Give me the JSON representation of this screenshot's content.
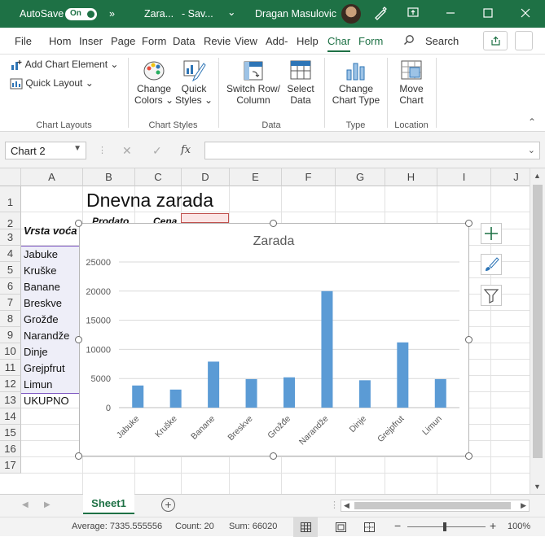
{
  "titlebar": {
    "autosave_label": "AutoSave",
    "autosave_state": "On",
    "more": "»",
    "doc_title": "Zara...",
    "save_state": "- Sav...",
    "dropdown": "⌄",
    "user_name": "Dragan Masulovic"
  },
  "menu": {
    "file": "File",
    "home": "Hom",
    "insert": "Inser",
    "page": "Page",
    "formulas": "Form",
    "data": "Data",
    "review": "Revie",
    "view": "View",
    "addins": "Add-",
    "help": "Help",
    "chart_design": "Char",
    "format": "Form",
    "search": "Search"
  },
  "ribbon": {
    "add_chart_element": "Add Chart Element",
    "quick_layout": "Quick Layout",
    "change_colors_1": "Change",
    "change_colors_2": "Colors",
    "quick_styles_1": "Quick",
    "quick_styles_2": "Styles",
    "switch_1": "Switch Row/",
    "switch_2": "Column",
    "select_1": "Select",
    "select_2": "Data",
    "change_type_1": "Change",
    "change_type_2": "Chart Type",
    "move_1": "Move",
    "move_2": "Chart",
    "group_layouts": "Chart Layouts",
    "group_styles": "Chart Styles",
    "group_data": "Data",
    "group_type": "Type",
    "group_location": "Location"
  },
  "formula_bar": {
    "name_box": "Chart 2",
    "fx": "fx",
    "cancel": "✕",
    "enter": "✓",
    "formula": ""
  },
  "columns": [
    "A",
    "B",
    "C",
    "D",
    "E",
    "F",
    "G",
    "H",
    "I",
    "J"
  ],
  "rows": [
    "1",
    "2",
    "3",
    "4",
    "5",
    "6",
    "7",
    "8",
    "9",
    "10",
    "11",
    "12",
    "13",
    "14",
    "15",
    "16",
    "17"
  ],
  "cells": {
    "title": "Dnevna zarada",
    "a2": "Vrsta voća",
    "b2": "Prodato",
    "c2": "Cena",
    "a3": "Jabuke",
    "a4": "Kruške",
    "a5": "Banane",
    "a6": "Breskve",
    "a7": "Grožđe",
    "a8": "Narandže",
    "a9": "Dinje",
    "a10": "Grejpfrut",
    "a11": "Limun",
    "a12": "UKUPNO"
  },
  "chart_data": {
    "type": "bar",
    "title": "Zarada",
    "categories": [
      "Jabuke",
      "Kruške",
      "Banane",
      "Breskve",
      "Grožđe",
      "Narandže",
      "Dinje",
      "Grejpfrut",
      "Limun"
    ],
    "values": [
      3800,
      3100,
      7900,
      4900,
      5200,
      20000,
      4700,
      11200,
      4900
    ],
    "ylim": [
      0,
      25000
    ],
    "yticks": [
      "0",
      "5000",
      "10000",
      "15000",
      "20000",
      "25000"
    ],
    "color": "#5b9bd5",
    "grid": true
  },
  "sheet": {
    "tab": "Sheet1",
    "add": "+"
  },
  "status": {
    "average": "Average: 7335.555556",
    "count": "Count: 20",
    "sum": "Sum: 66020",
    "zoom": "100%",
    "minus": "−",
    "plus": "+"
  }
}
